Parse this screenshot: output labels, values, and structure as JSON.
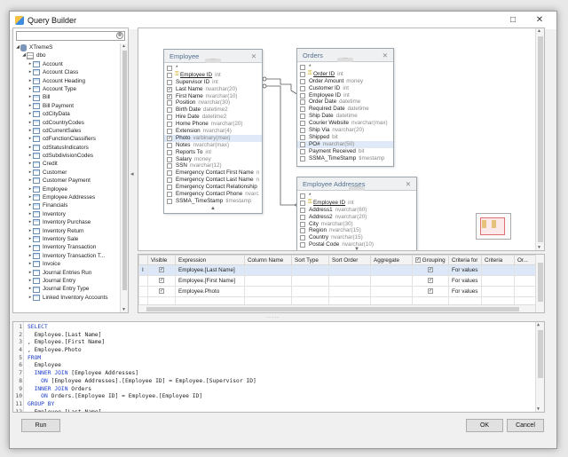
{
  "window": {
    "title": "Query Builder",
    "min_glyph": "□",
    "close_glyph": "✕"
  },
  "tree": {
    "search_clear_glyph": "⊗",
    "server": "XTremeS",
    "schema": "dbo",
    "items": [
      "Account",
      "Account Class",
      "Account Heading",
      "Account Type",
      "Bill",
      "Bill Payment",
      "cdCityData",
      "cdCountryCodes",
      "cdCurrentSales",
      "cdFunctionClassifiers",
      "cdStatusIndicators",
      "cdSubdivisionCodes",
      "Credit",
      "Customer",
      "Customer Payment",
      "Employee",
      "Employee Addresses",
      "Financials",
      "Inventory",
      "Inventory Purchase",
      "Inventory Return",
      "Inventory Sale",
      "Inventory Transaction",
      "Inventory Transaction T...",
      "Invoice",
      "Journal Entries Run",
      "Journal Entry",
      "Journal Entry Type",
      "Linked Inventory Accounts"
    ]
  },
  "diagram": {
    "tables": [
      {
        "title": "Employee",
        "fields": [
          {
            "name": "*",
            "type": "",
            "checked": false,
            "key": false,
            "sel": false
          },
          {
            "name": "Employee ID",
            "type": "int",
            "checked": false,
            "key": true,
            "sel": false
          },
          {
            "name": "Supervisor ID",
            "type": "int",
            "checked": false,
            "key": false,
            "sel": false
          },
          {
            "name": "Last Name",
            "type": "nvarchar(20)",
            "checked": true,
            "key": false,
            "sel": false
          },
          {
            "name": "First Name",
            "type": "nvarchar(10)",
            "checked": true,
            "key": false,
            "sel": false
          },
          {
            "name": "Position",
            "type": "nvarchar(30)",
            "checked": false,
            "key": false,
            "sel": false
          },
          {
            "name": "Birth Date",
            "type": "datetime2",
            "checked": false,
            "key": false,
            "sel": false
          },
          {
            "name": "Hire Date",
            "type": "datetime2",
            "checked": false,
            "key": false,
            "sel": false
          },
          {
            "name": "Home Phone",
            "type": "nvarchar(20)",
            "checked": false,
            "key": false,
            "sel": false
          },
          {
            "name": "Extension",
            "type": "nvarchar(4)",
            "checked": false,
            "key": false,
            "sel": false
          },
          {
            "name": "Photo",
            "type": "varbinary(max)",
            "checked": true,
            "key": false,
            "sel": true
          },
          {
            "name": "Notes",
            "type": "nvarchar(max)",
            "checked": false,
            "key": false,
            "sel": false
          },
          {
            "name": "Reports To",
            "type": "int",
            "checked": false,
            "key": false,
            "sel": false
          },
          {
            "name": "Salary",
            "type": "money",
            "checked": false,
            "key": false,
            "sel": false
          },
          {
            "name": "SSN",
            "type": "nvarchar(12)",
            "checked": false,
            "key": false,
            "sel": false
          },
          {
            "name": "Emergency Contact First Name",
            "type": "n",
            "checked": false,
            "key": false,
            "sel": false
          },
          {
            "name": "Emergency Contact Last Name",
            "type": "n",
            "checked": false,
            "key": false,
            "sel": false
          },
          {
            "name": "Emergency Contact Relationship",
            "type": "",
            "checked": false,
            "key": false,
            "sel": false
          },
          {
            "name": "Emergency Contact Phone",
            "type": "nvarc",
            "checked": false,
            "key": false,
            "sel": false
          },
          {
            "name": "SSMA_TimeStamp",
            "type": "timestamp",
            "checked": false,
            "key": false,
            "sel": false
          }
        ]
      },
      {
        "title": "Orders",
        "fields": [
          {
            "name": "*",
            "type": "",
            "checked": false,
            "key": false,
            "sel": false
          },
          {
            "name": "Order ID",
            "type": "int",
            "checked": false,
            "key": true,
            "sel": false
          },
          {
            "name": "Order Amount",
            "type": "money",
            "checked": false,
            "key": false,
            "sel": false
          },
          {
            "name": "Customer ID",
            "type": "int",
            "checked": false,
            "key": false,
            "sel": false
          },
          {
            "name": "Employee ID",
            "type": "int",
            "checked": false,
            "key": false,
            "sel": false
          },
          {
            "name": "Order Date",
            "type": "datetime",
            "checked": false,
            "key": false,
            "sel": false
          },
          {
            "name": "Required Date",
            "type": "datetime",
            "checked": false,
            "key": false,
            "sel": false
          },
          {
            "name": "Ship Date",
            "type": "datetime",
            "checked": false,
            "key": false,
            "sel": false
          },
          {
            "name": "Courier Website",
            "type": "nvarchar(max)",
            "checked": false,
            "key": false,
            "sel": false
          },
          {
            "name": "Ship Via",
            "type": "nvarchar(20)",
            "checked": false,
            "key": false,
            "sel": false
          },
          {
            "name": "Shipped",
            "type": "bit",
            "checked": false,
            "key": false,
            "sel": false
          },
          {
            "name": "PO#",
            "type": "nvarchar(50)",
            "checked": false,
            "key": false,
            "sel": true
          },
          {
            "name": "Payment Received",
            "type": "bit",
            "checked": false,
            "key": false,
            "sel": false
          },
          {
            "name": "SSMA_TimeStamp",
            "type": "timestamp",
            "checked": false,
            "key": false,
            "sel": false
          }
        ]
      },
      {
        "title": "Employee Addresses",
        "fields": [
          {
            "name": "*",
            "type": "",
            "checked": false,
            "key": false,
            "sel": false
          },
          {
            "name": "Employee ID",
            "type": "int",
            "checked": false,
            "key": true,
            "sel": false
          },
          {
            "name": "Address1",
            "type": "nvarchar(60)",
            "checked": false,
            "key": false,
            "sel": false
          },
          {
            "name": "Address2",
            "type": "nvarchar(20)",
            "checked": false,
            "key": false,
            "sel": false
          },
          {
            "name": "City",
            "type": "nvarchar(30)",
            "checked": false,
            "key": false,
            "sel": false
          },
          {
            "name": "Region",
            "type": "nvarchar(15)",
            "checked": false,
            "key": false,
            "sel": false
          },
          {
            "name": "Country",
            "type": "nvarchar(15)",
            "checked": false,
            "key": false,
            "sel": false
          },
          {
            "name": "Postal Code",
            "type": "nvarchar(10)",
            "checked": false,
            "key": false,
            "sel": false
          }
        ]
      }
    ]
  },
  "grid": {
    "columns": [
      "",
      "Visible",
      "Expression",
      "Column Name",
      "Sort Type",
      "Sort Order",
      "Aggregate",
      "Grouping",
      "Criteria for",
      "Criteria",
      "Or..."
    ],
    "rows": [
      {
        "marker": "I",
        "visible": true,
        "expression": "Employee.[Last Name]",
        "grouping": true,
        "criteria_for": "For values",
        "selected": true
      },
      {
        "marker": "",
        "visible": true,
        "expression": "Employee.[First Name]",
        "grouping": true,
        "criteria_for": "For values",
        "selected": false
      },
      {
        "marker": "",
        "visible": true,
        "expression": "Employee.Photo",
        "grouping": true,
        "criteria_for": "For values",
        "selected": false
      }
    ]
  },
  "sql": {
    "lines": [
      {
        "n": "1",
        "kw": "SELECT",
        "rest": ""
      },
      {
        "n": "2",
        "kw": "",
        "rest": "  Employee.[Last Name]"
      },
      {
        "n": "3",
        "kw": "",
        "rest": ", Employee.[First Name]"
      },
      {
        "n": "4",
        "kw": "",
        "rest": ", Employee.Photo"
      },
      {
        "n": "5",
        "kw": "FROM",
        "rest": ""
      },
      {
        "n": "6",
        "kw": "",
        "rest": "  Employee"
      },
      {
        "n": "7",
        "kw": "  INNER JOIN",
        "rest": " [Employee Addresses]"
      },
      {
        "n": "8",
        "kw": "    ON",
        "rest": " [Employee Addresses].[Employee ID] = Employee.[Supervisor ID]"
      },
      {
        "n": "9",
        "kw": "  INNER JOIN",
        "rest": " Orders"
      },
      {
        "n": "10",
        "kw": "    ON",
        "rest": " Orders.[Employee ID] = Employee.[Employee ID]"
      },
      {
        "n": "11",
        "kw": "GROUP BY",
        "rest": ""
      },
      {
        "n": "12",
        "kw": "",
        "rest": "  Employee.[Last Name],"
      }
    ]
  },
  "buttons": {
    "run": "Run",
    "ok": "OK",
    "cancel": "Cancel"
  },
  "colors": {
    "keyword": "#1a3cc9",
    "accent": "#55708f"
  }
}
